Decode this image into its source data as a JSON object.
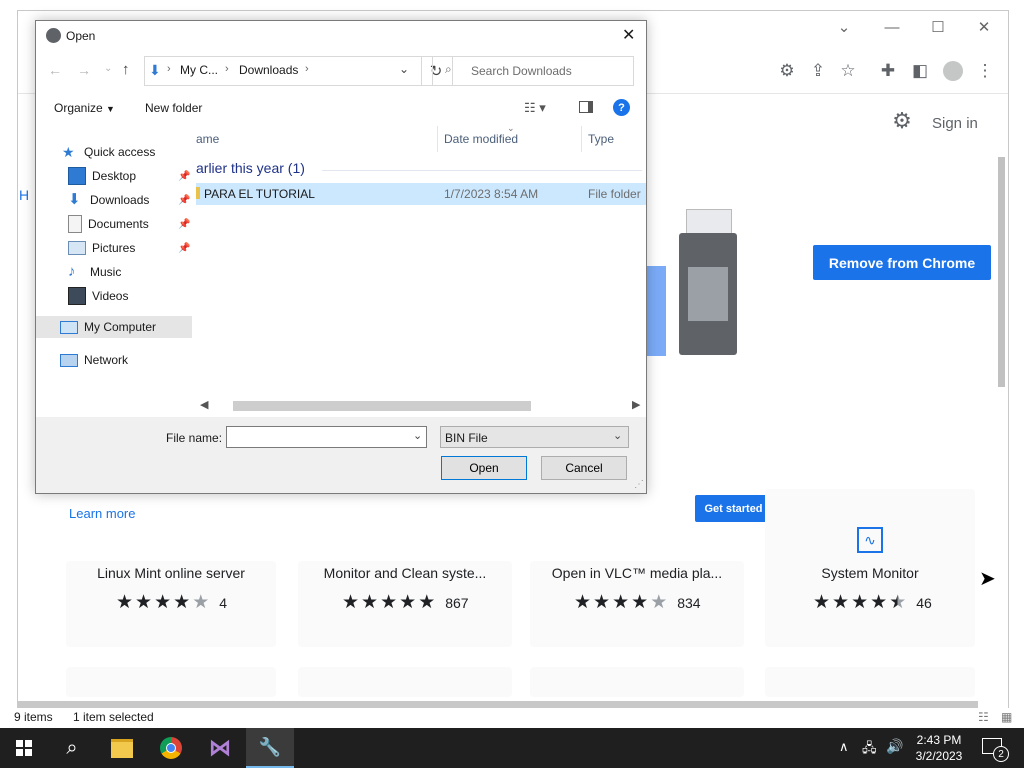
{
  "chrome": {
    "sign_in": "Sign in",
    "remove_button": "Remove from Chrome",
    "learn_more": "Learn more",
    "get_started": "Get started",
    "left_edge_letter": "H",
    "cards": [
      {
        "title": "Linux Mint online server",
        "stars": 4,
        "count": "4"
      },
      {
        "title": "Monitor and Clean syste...",
        "stars": 5,
        "count": "867"
      },
      {
        "title": "Open in VLC™ media pla...",
        "stars": 4,
        "count": "834"
      },
      {
        "title": "System Monitor",
        "stars": 4.5,
        "count": "46"
      }
    ]
  },
  "dialog": {
    "title": "Open",
    "breadcrumb": [
      "My C...",
      "Downloads"
    ],
    "search_placeholder": "Search Downloads",
    "organize": "Organize",
    "new_folder": "New folder",
    "nav": {
      "quick_access": "Quick access",
      "desktop": "Desktop",
      "downloads": "Downloads",
      "documents": "Documents",
      "pictures": "Pictures",
      "music": "Music",
      "videos": "Videos",
      "my_computer": "My Computer",
      "network": "Network"
    },
    "columns": {
      "name": "ame",
      "date": "Date modified",
      "type": "Type"
    },
    "group_label": "arlier this year (1)",
    "files": [
      {
        "name": "PARA EL TUTORIAL",
        "date": "1/7/2023 8:54 AM",
        "type": "File folder"
      }
    ],
    "file_name_label": "File name:",
    "file_name_value": "",
    "filter": "BIN File",
    "open_button": "Open",
    "cancel_button": "Cancel"
  },
  "explorer_status": {
    "items": "9 items",
    "selected": "1 item selected"
  },
  "taskbar": {
    "time": "2:43 PM",
    "date": "3/2/2023",
    "notification_count": "2"
  },
  "colors": {
    "accent": "#1a73e8",
    "selection": "#cce8ff",
    "taskbar": "#1f1f1f"
  }
}
